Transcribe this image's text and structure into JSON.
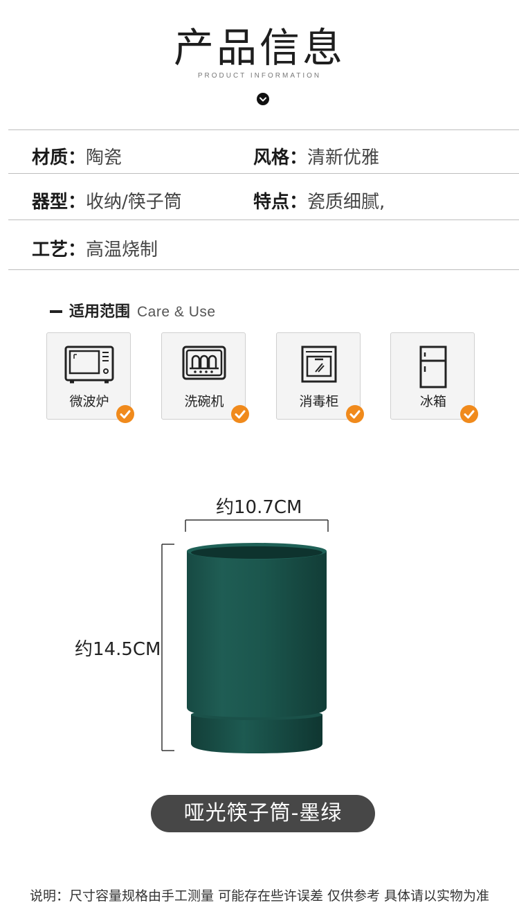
{
  "header": {
    "title": "产品信息",
    "subtitle": "PRODUCT INFORMATION",
    "scroll_icon": "chevron-down-circle-icon"
  },
  "info": {
    "material": {
      "label": "材质：",
      "value": "陶瓷"
    },
    "style": {
      "label": "风格：",
      "value": "清新优雅"
    },
    "type": {
      "label": "器型：",
      "value": "收纳/筷子筒"
    },
    "feature": {
      "label": "特点：",
      "value": "瓷质细腻,"
    },
    "craft": {
      "label": "工艺：",
      "value": "高温烧制"
    }
  },
  "care": {
    "heading_cn": "适用范围",
    "heading_en": "Care & Use",
    "items": [
      {
        "label": "微波炉",
        "icon": "microwave-icon"
      },
      {
        "label": "洗碗机",
        "icon": "dishwasher-icon"
      },
      {
        "label": "消毒柜",
        "icon": "sterilizer-cabinet-icon"
      },
      {
        "label": "冰箱",
        "icon": "refrigerator-icon"
      }
    ],
    "check_color": "#f08a1c"
  },
  "product": {
    "width_label": "约10.7CM",
    "height_label": "约14.5CM",
    "caption": "哑光筷子筒-墨绿",
    "body_color": "#1e5a52"
  },
  "footer": {
    "note": "说明：尺寸容量规格由手工测量 可能存在些许误差 仅供参考 具体请以实物为准"
  }
}
